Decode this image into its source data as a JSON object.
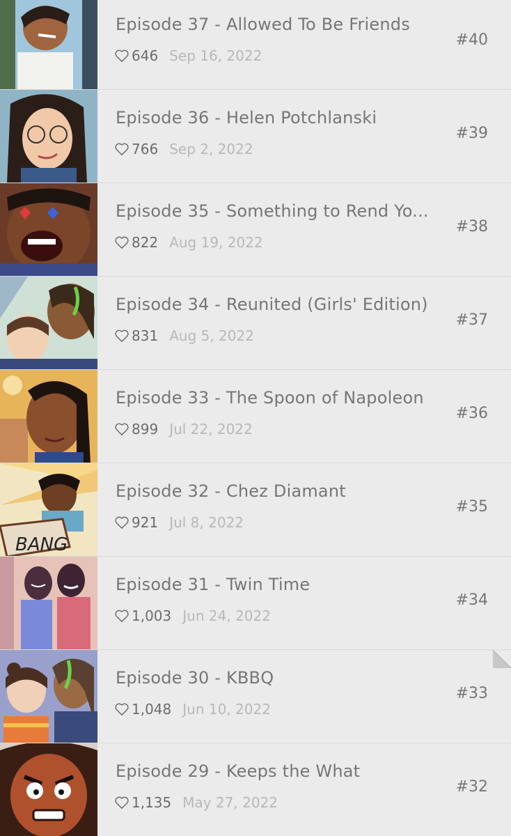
{
  "episodes": [
    {
      "title": "Episode 37 - Allowed To Be Friends",
      "likes": "646",
      "date": "Sep 16, 2022",
      "number": "#40"
    },
    {
      "title": "Episode 36 - Helen Potchlanski",
      "likes": "766",
      "date": "Sep 2, 2022",
      "number": "#39"
    },
    {
      "title": "Episode 35 - Something to Rend Yo...",
      "likes": "822",
      "date": "Aug 19, 2022",
      "number": "#38"
    },
    {
      "title": "Episode 34 - Reunited (Girls' Edition)",
      "likes": "831",
      "date": "Aug 5, 2022",
      "number": "#37"
    },
    {
      "title": "Episode 33 - The Spoon of Napoleon",
      "likes": "899",
      "date": "Jul 22, 2022",
      "number": "#36"
    },
    {
      "title": "Episode 32 - Chez Diamant",
      "likes": "921",
      "date": "Jul 8, 2022",
      "number": "#35"
    },
    {
      "title": "Episode 31 - Twin Time",
      "likes": "1,003",
      "date": "Jun 24, 2022",
      "number": "#34"
    },
    {
      "title": "Episode 30 - KBBQ",
      "likes": "1,048",
      "date": "Jun 10, 2022",
      "number": "#33"
    },
    {
      "title": "Episode 29 - Keeps the What",
      "likes": "1,135",
      "date": "May 27, 2022",
      "number": "#32"
    }
  ],
  "icons": {
    "like": "heart-outline-icon",
    "thumbnail": "episode-thumbnail"
  },
  "colors": {
    "background": "#ebebeb",
    "title": "#767676",
    "date": "#b8b8b8",
    "divider": "#d9d9d9"
  }
}
